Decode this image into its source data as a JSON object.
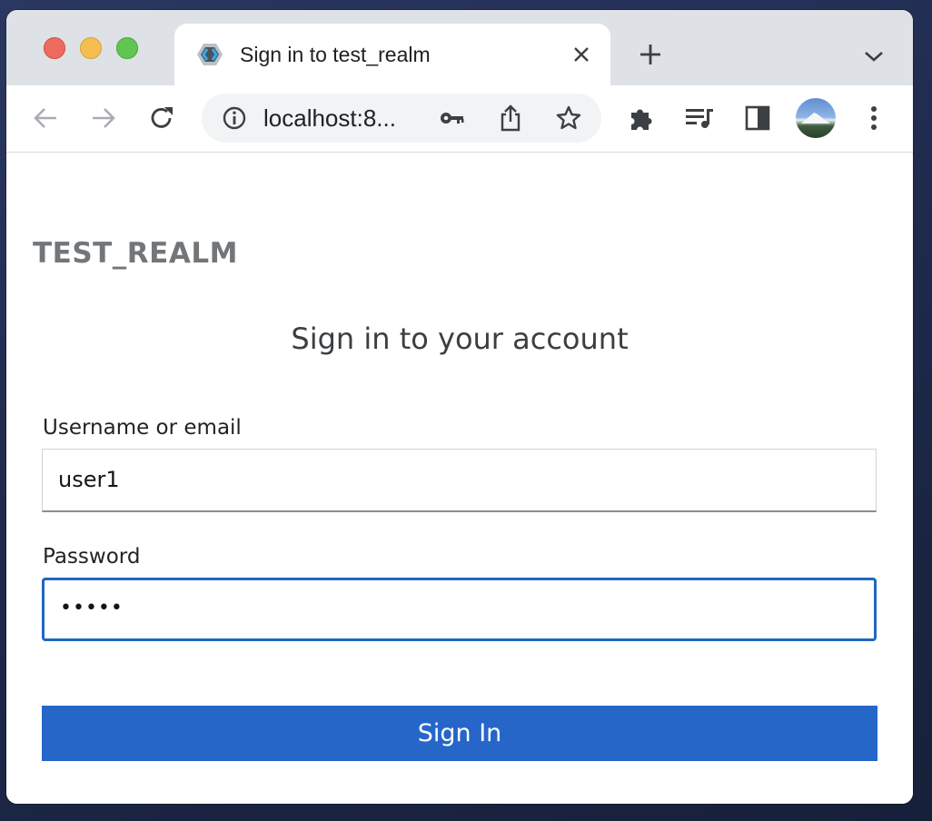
{
  "browser": {
    "tab": {
      "title": "Sign in to test_realm",
      "favicon": "keycloak-icon",
      "close_icon": "close-icon"
    },
    "new_tab_icon": "plus-icon",
    "tab_search_icon": "chevron-down-icon",
    "toolbar": {
      "back_icon": "arrow-left-icon",
      "forward_icon": "arrow-right-icon",
      "reload_icon": "reload-icon",
      "url": "localhost:8...",
      "site_info_icon": "info-icon",
      "password_icon": "key-icon",
      "share_icon": "share-icon",
      "bookmark_icon": "star-icon",
      "extensions_icon": "puzzle-icon",
      "media_icon": "media-queue-icon",
      "side_panel_icon": "side-panel-icon",
      "menu_icon": "kebab-menu-icon"
    }
  },
  "login": {
    "realm_name": "TEST_REALM",
    "heading": "Sign in to your account",
    "username_label": "Username or email",
    "username_value": "user1",
    "password_label": "Password",
    "password_value": "•••••",
    "submit_label": "Sign In"
  },
  "colors": {
    "primary_button": "#2566c8",
    "focus_border": "#1f67c1",
    "traffic_close": "#ed6a5e",
    "traffic_minimize": "#f5bf4f",
    "traffic_maximize": "#61c554"
  }
}
